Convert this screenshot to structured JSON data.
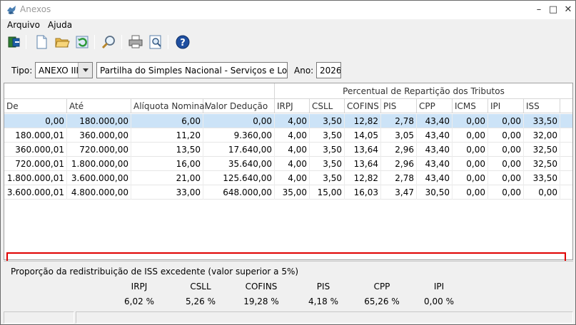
{
  "window": {
    "title": "Anexos"
  },
  "menu": {
    "items": [
      "Arquivo",
      "Ajuda"
    ]
  },
  "toolbar": {
    "buttons": [
      "exit-icon",
      "new-document-icon",
      "open-folder-icon",
      "refresh-icon",
      "search-icon",
      "print-icon",
      "print-preview-icon",
      "help-icon"
    ]
  },
  "filter": {
    "tipo_label": "Tipo:",
    "tipo_value": "ANEXO III",
    "descricao": "Partilha do Simples Nacional - Serviços e Locação",
    "ano_label": "Ano:",
    "ano_value": "2026"
  },
  "grid": {
    "group_header": "Percentual de Repartição dos Tributos",
    "columns": [
      "De",
      "Até",
      "Alíquota Nominal",
      "Valor Dedução",
      "IRPJ",
      "CSLL",
      "COFINS",
      "PIS",
      "CPP",
      "ICMS",
      "IPI",
      "ISS"
    ],
    "rows": [
      [
        "0,00",
        "180.000,00",
        "6,00",
        "0,00",
        "4,00",
        "3,50",
        "12,82",
        "2,78",
        "43,40",
        "0,00",
        "0,00",
        "33,50"
      ],
      [
        "180.000,01",
        "360.000,00",
        "11,20",
        "9.360,00",
        "4,00",
        "3,50",
        "14,05",
        "3,05",
        "43,40",
        "0,00",
        "0,00",
        "32,00"
      ],
      [
        "360.000,01",
        "720.000,00",
        "13,50",
        "17.640,00",
        "4,00",
        "3,50",
        "13,64",
        "2,96",
        "43,40",
        "0,00",
        "0,00",
        "32,50"
      ],
      [
        "720.000,01",
        "1.800.000,00",
        "16,00",
        "35.640,00",
        "4,00",
        "3,50",
        "13,64",
        "2,96",
        "43,40",
        "0,00",
        "0,00",
        "32,50"
      ],
      [
        "1.800.000,01",
        "3.600.000,00",
        "21,00",
        "125.640,00",
        "4,00",
        "3,50",
        "12,82",
        "2,78",
        "43,40",
        "0,00",
        "0,00",
        "33,50"
      ],
      [
        "3.600.000,01",
        "4.800.000,00",
        "33,00",
        "648.000,00",
        "35,00",
        "15,00",
        "16,03",
        "3,47",
        "30,50",
        "0,00",
        "0,00",
        "0,00"
      ]
    ],
    "selected_row": 0,
    "highlighted_row": 4
  },
  "iss_panel": {
    "title": "Proporção da redistribuição de ISS excedente (valor superior a 5%)",
    "headers": [
      "IRPJ",
      "CSLL",
      "COFINS",
      "PIS",
      "CPP",
      "IPI"
    ],
    "values": [
      "6,02 %",
      "5,26 %",
      "19,28 %",
      "4,18 %",
      "65,26 %",
      "0,00 %"
    ]
  },
  "colors": {
    "selected_row": "#cce3f7",
    "highlight_border": "#e00000"
  }
}
